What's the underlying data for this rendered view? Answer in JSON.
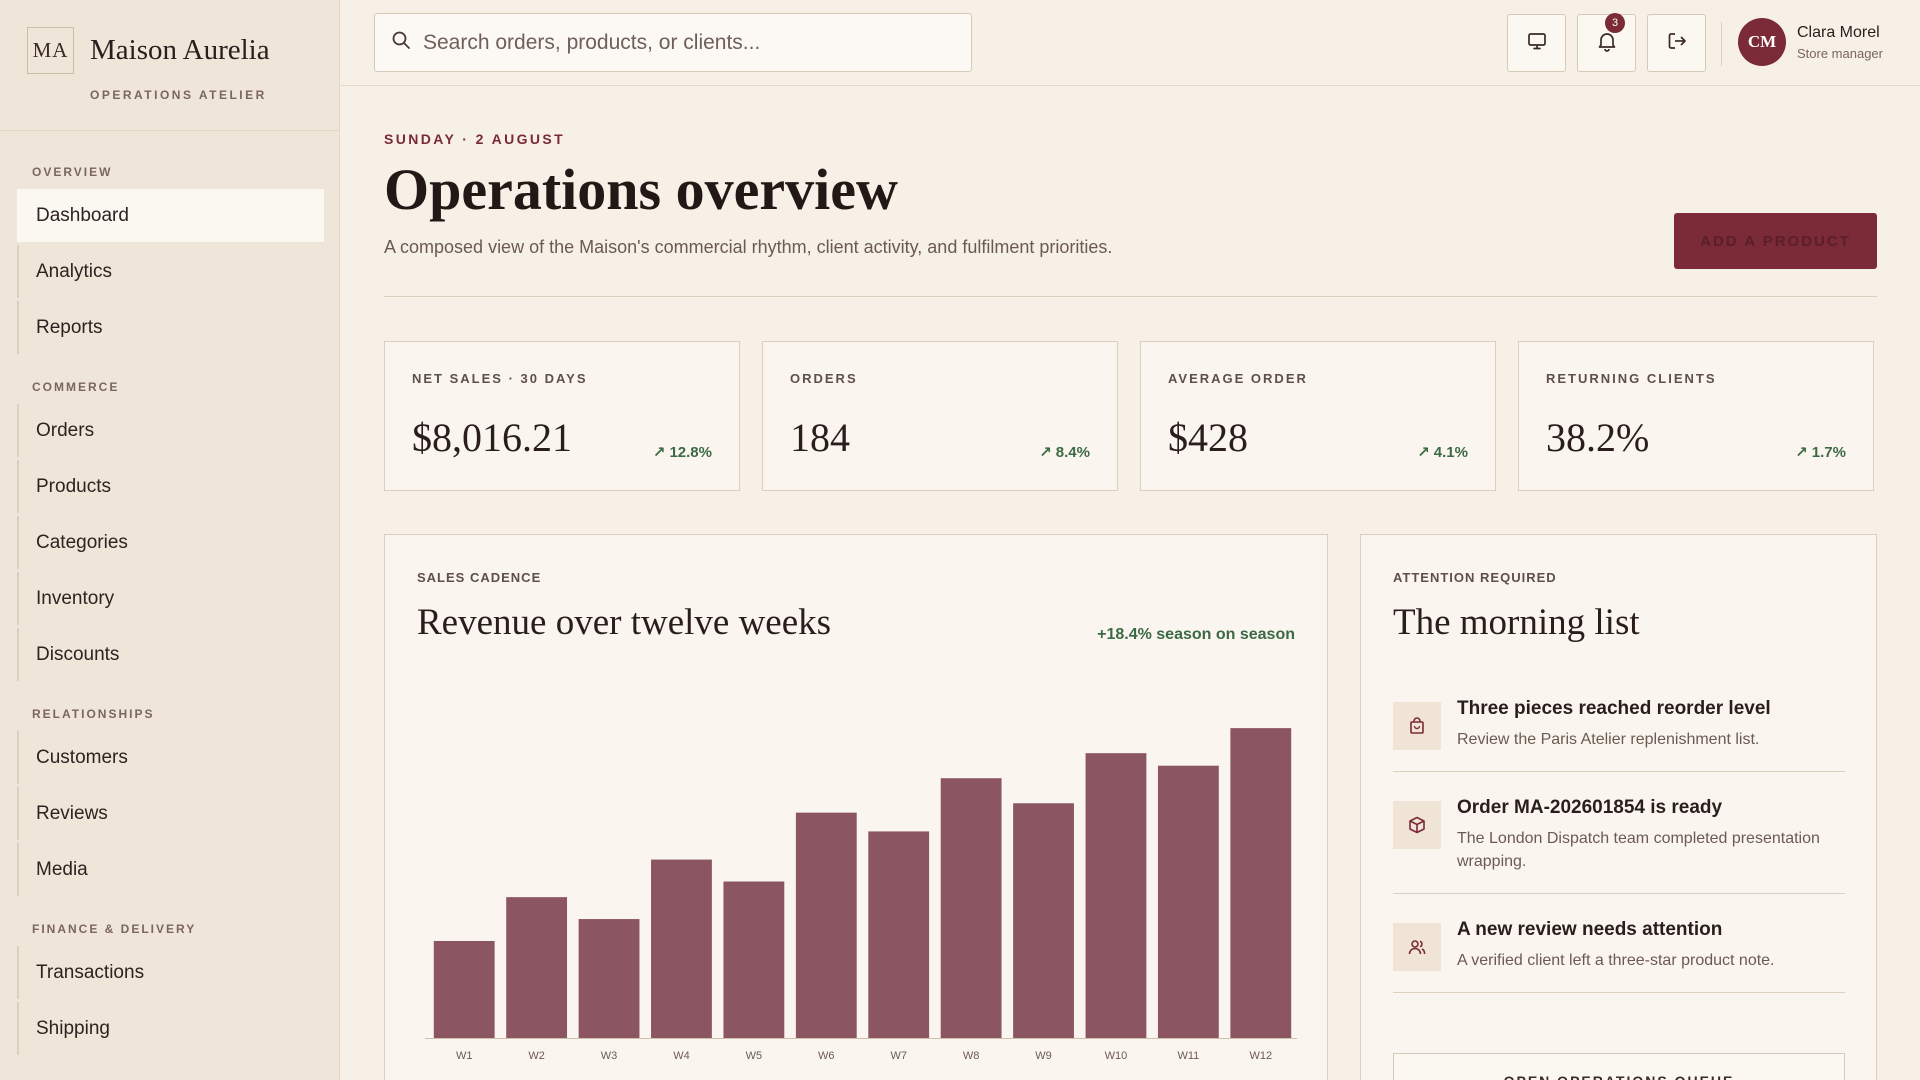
{
  "brand": {
    "mark": "MA",
    "name": "Maison Aurelia",
    "subtitle": "OPERATIONS ATELIER"
  },
  "sidebar": {
    "sections": [
      {
        "title": "OVERVIEW",
        "items": [
          "Dashboard",
          "Analytics",
          "Reports"
        ]
      },
      {
        "title": "COMMERCE",
        "items": [
          "Orders",
          "Products",
          "Categories",
          "Inventory",
          "Discounts"
        ]
      },
      {
        "title": "RELATIONSHIPS",
        "items": [
          "Customers",
          "Reviews",
          "Media"
        ]
      },
      {
        "title": "FINANCE & DELIVERY",
        "items": [
          "Transactions",
          "Shipping"
        ]
      }
    ],
    "active": "Dashboard"
  },
  "topbar": {
    "search_placeholder": "Search orders, products, or clients...",
    "notification_count": "3",
    "user": {
      "initials": "CM",
      "name": "Clara Morel",
      "role": "Store manager"
    }
  },
  "header": {
    "date": "SUNDAY · 2 AUGUST",
    "title": "Operations overview",
    "description": "A composed view of the Maison's commercial rhythm, client activity, and fulfilment priorities.",
    "add_button": "ADD A PRODUCT"
  },
  "kpis": [
    {
      "label": "NET SALES · 30 DAYS",
      "value": "$8,016.21",
      "delta": "↗ 12.8%"
    },
    {
      "label": "ORDERS",
      "value": "184",
      "delta": "↗ 8.4%"
    },
    {
      "label": "AVERAGE ORDER",
      "value": "$428",
      "delta": "↗ 4.1%"
    },
    {
      "label": "RETURNING CLIENTS",
      "value": "38.2%",
      "delta": "↗ 1.7%"
    }
  ],
  "chart_panel": {
    "eyebrow": "SALES CADENCE",
    "title": "Revenue over twelve weeks",
    "note": "+18.4% season on season"
  },
  "chart_data": {
    "type": "bar",
    "categories": [
      "W1",
      "W2",
      "W3",
      "W4",
      "W5",
      "W6",
      "W7",
      "W8",
      "W9",
      "W10",
      "W11",
      "W12"
    ],
    "values": [
      31,
      45,
      38,
      57,
      50,
      72,
      66,
      83,
      75,
      91,
      87,
      99
    ],
    "ylim": [
      0,
      100
    ],
    "color": "#8c5562",
    "grid": false
  },
  "list_panel": {
    "eyebrow": "ATTENTION REQUIRED",
    "title": "The morning list",
    "items": [
      {
        "icon": "shopping-bag-icon",
        "title": "Three pieces reached reorder level",
        "sub": "Review the Paris Atelier replenishment list."
      },
      {
        "icon": "package-icon",
        "title": "Order MA-202601854 is ready",
        "sub": "The London Dispatch team completed presentation wrapping."
      },
      {
        "icon": "users-icon",
        "title": "A new review needs attention",
        "sub": "A verified client left a three-star product note."
      }
    ],
    "open_button": "OPEN OPERATIONS QUEUE"
  },
  "colors": {
    "accent": "#7b2a37",
    "bar": "#8c5562",
    "positive": "#3c6a45",
    "background": "#f6f0e7"
  }
}
